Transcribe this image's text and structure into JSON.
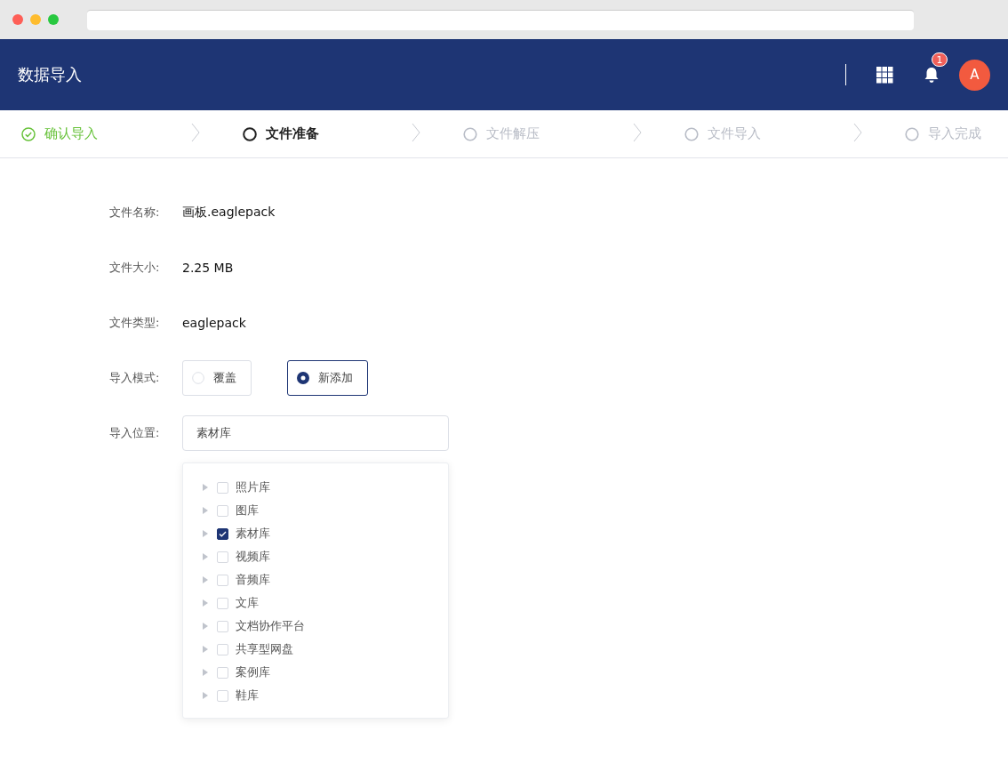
{
  "header": {
    "title": "数据导入",
    "notification_count": "1",
    "avatar": "A"
  },
  "steps": [
    {
      "label": "确认导入",
      "kind": "done"
    },
    {
      "label": "文件准备",
      "kind": "current"
    },
    {
      "label": "文件解压",
      "kind": "pending"
    },
    {
      "label": "文件导入",
      "kind": "pending"
    },
    {
      "label": "导入完成",
      "kind": "pending"
    }
  ],
  "fields": [
    {
      "label": "文件名称:",
      "value": "画板.eaglepack"
    },
    {
      "label": "文件大小:",
      "value": "2.25 MB"
    },
    {
      "label": "文件类型:",
      "value": "eaglepack"
    }
  ],
  "import_mode": {
    "label": "导入模式:",
    "options": [
      {
        "label": "覆盖",
        "selected": false
      },
      {
        "label": "新添加",
        "selected": true
      }
    ]
  },
  "import_location": {
    "label": "导入位置:",
    "value": "素材库",
    "tree": [
      {
        "label": "照片库",
        "checked": false,
        "expanded": false
      },
      {
        "label": "图库",
        "checked": false,
        "expanded": false
      },
      {
        "label": "素材库",
        "checked": true,
        "expanded": false
      },
      {
        "label": "视频库",
        "checked": false,
        "expanded": false
      },
      {
        "label": "音频库",
        "checked": false,
        "expanded": false
      },
      {
        "label": "文库",
        "checked": false,
        "expanded": false
      },
      {
        "label": "文档协作平台",
        "checked": false,
        "expanded": false
      },
      {
        "label": "共享型网盘",
        "checked": false,
        "expanded": false
      },
      {
        "label": "案例库",
        "checked": false,
        "expanded": false
      },
      {
        "label": "鞋库",
        "checked": false,
        "expanded": false
      }
    ]
  }
}
